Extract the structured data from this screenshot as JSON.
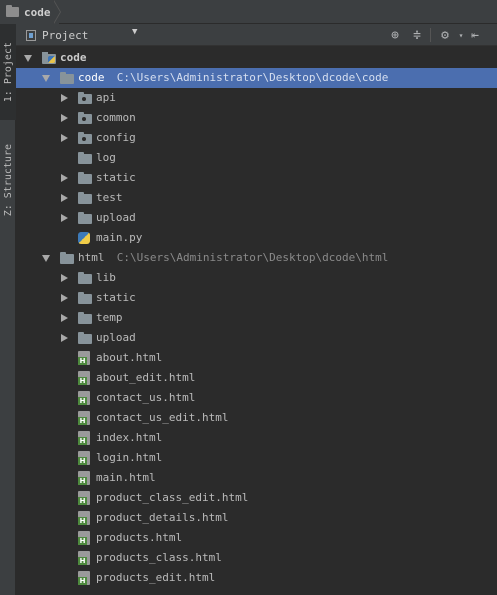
{
  "breadcrumb": {
    "label": "code"
  },
  "side_tabs": [
    {
      "label": "1: Project",
      "icon": "project-folder-icon"
    },
    {
      "label": "Z: Structure",
      "icon": "structure-icon"
    }
  ],
  "toolbar": {
    "view_label": "Project",
    "icons": [
      "target-icon",
      "collapse-icon",
      "gear-icon",
      "hide-icon"
    ]
  },
  "tree": [
    {
      "label": "code",
      "type": "module",
      "depth": 0,
      "expanded": true,
      "bold": true
    },
    {
      "label": "code",
      "path": "C:\\Users\\Administrator\\Desktop\\dcode\\code",
      "type": "folder",
      "depth": 1,
      "expanded": true,
      "selected": true
    },
    {
      "label": "api",
      "type": "package",
      "depth": 2,
      "expanded": false
    },
    {
      "label": "common",
      "type": "package",
      "depth": 2,
      "expanded": false
    },
    {
      "label": "config",
      "type": "package",
      "depth": 2,
      "expanded": false
    },
    {
      "label": "log",
      "type": "folder",
      "depth": 2
    },
    {
      "label": "static",
      "type": "folder",
      "depth": 2,
      "expanded": false
    },
    {
      "label": "test",
      "type": "folder",
      "depth": 2,
      "expanded": false
    },
    {
      "label": "upload",
      "type": "folder",
      "depth": 2,
      "expanded": false
    },
    {
      "label": "main.py",
      "type": "python",
      "depth": 2
    },
    {
      "label": "html",
      "path": "C:\\Users\\Administrator\\Desktop\\dcode\\html",
      "type": "folder",
      "depth": 1,
      "expanded": true
    },
    {
      "label": "lib",
      "type": "folder",
      "depth": 2,
      "expanded": false
    },
    {
      "label": "static",
      "type": "folder",
      "depth": 2,
      "expanded": false
    },
    {
      "label": "temp",
      "type": "folder",
      "depth": 2,
      "expanded": false
    },
    {
      "label": "upload",
      "type": "folder",
      "depth": 2,
      "expanded": false
    },
    {
      "label": "about.html",
      "type": "html",
      "depth": 2
    },
    {
      "label": "about_edit.html",
      "type": "html",
      "depth": 2
    },
    {
      "label": "contact_us.html",
      "type": "html",
      "depth": 2
    },
    {
      "label": "contact_us_edit.html",
      "type": "html",
      "depth": 2
    },
    {
      "label": "index.html",
      "type": "html",
      "depth": 2
    },
    {
      "label": "login.html",
      "type": "html",
      "depth": 2
    },
    {
      "label": "main.html",
      "type": "html",
      "depth": 2
    },
    {
      "label": "product_class_edit.html",
      "type": "html",
      "depth": 2
    },
    {
      "label": "product_details.html",
      "type": "html",
      "depth": 2
    },
    {
      "label": "products.html",
      "type": "html",
      "depth": 2
    },
    {
      "label": "products_class.html",
      "type": "html",
      "depth": 2
    },
    {
      "label": "products_edit.html",
      "type": "html",
      "depth": 2
    }
  ]
}
